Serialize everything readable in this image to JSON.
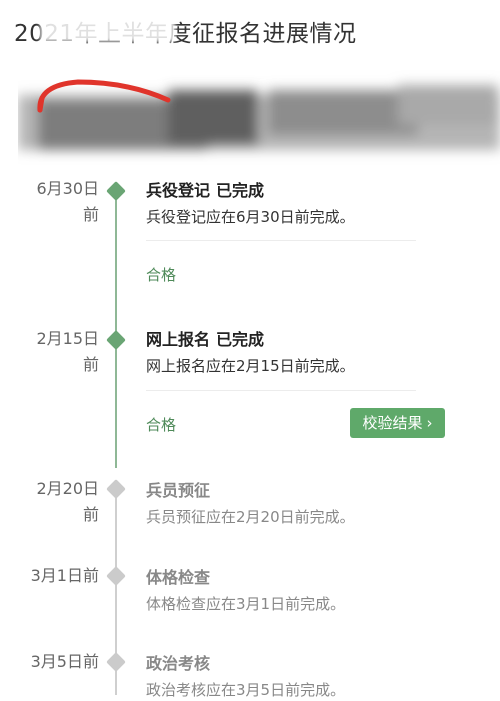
{
  "header": {
    "title": "2021年上半年度征报名进展情况"
  },
  "colors": {
    "accent": "#5fa96a",
    "done_node": "#6aa574",
    "pending_node": "#cbcbcb"
  },
  "steps": [
    {
      "date_line1": "6月30日",
      "date_line2": "前",
      "title": "兵役登记",
      "status": "已完成",
      "desc": "兵役登记应在6月30日前完成。",
      "result": "合格"
    },
    {
      "date_line1": "2月15日",
      "date_line2": "前",
      "title": "网上报名",
      "status": "已完成",
      "desc": "网上报名应在2月15日前完成。",
      "result": "合格",
      "button": "校验结果"
    },
    {
      "date_line1": "2月20日",
      "date_line2": "前",
      "title": "兵员预征",
      "desc": "兵员预征应在2月20日前完成。"
    },
    {
      "date_line1": "3月1日前",
      "title": "体格检查",
      "desc": "体格检查应在3月1日前完成。"
    },
    {
      "date_line1": "3月5日前",
      "title": "政治考核",
      "desc": "政治考核应在3月5日前完成。"
    }
  ]
}
